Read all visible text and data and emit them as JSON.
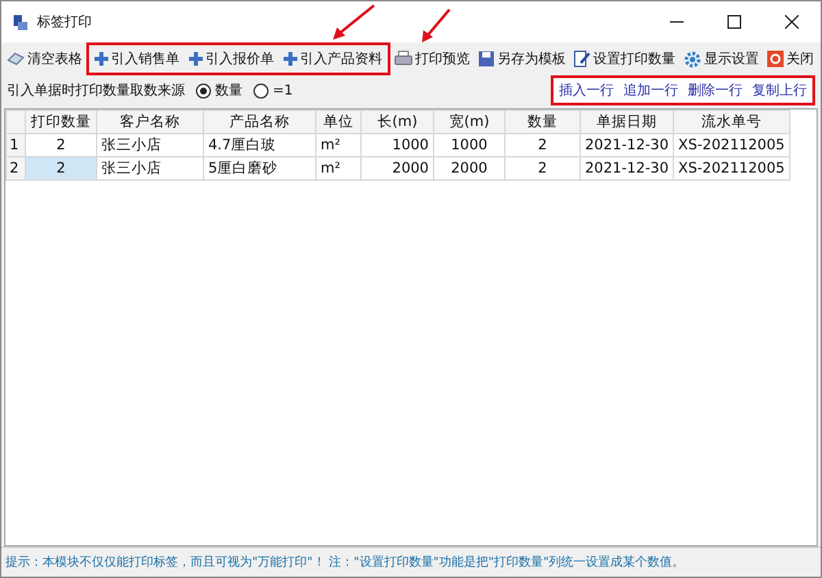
{
  "window": {
    "title": "标签打印"
  },
  "toolbar": {
    "items_before": [
      {
        "label": "清空表格",
        "kind": "eraser"
      }
    ],
    "highlighted_group": [
      {
        "label": "引入销售单",
        "kind": "plus"
      },
      {
        "label": "引入报价单",
        "kind": "plus"
      },
      {
        "label": "引入产品资料",
        "kind": "plus"
      }
    ],
    "items_after": [
      {
        "label": "打印预览",
        "kind": "printer"
      },
      {
        "label": "另存为模板",
        "kind": "save"
      },
      {
        "label": "设置打印数量",
        "kind": "edit"
      },
      {
        "label": "显示设置",
        "kind": "gear"
      },
      {
        "label": "关闭",
        "kind": "close"
      }
    ]
  },
  "options": {
    "label": "引入单据时打印数量取数来源",
    "radios": [
      {
        "label": "数量",
        "selected": true
      },
      {
        "label": "=1",
        "selected": false
      }
    ]
  },
  "row_actions": [
    "插入一行",
    "追加一行",
    "删除一行",
    "复制上行"
  ],
  "table": {
    "columns": [
      "打印数量",
      "客户名称",
      "产品名称",
      "单位",
      "长(m)",
      "宽(m)",
      "数量",
      "单据日期",
      "流水单号"
    ],
    "rows": [
      {
        "number": "1",
        "current": false,
        "cells": [
          "2",
          "张三小店",
          "4.7厘白玻",
          "m²",
          "1000",
          "1000",
          "2",
          "2021-12-30",
          "XS-202112005"
        ]
      },
      {
        "number": "2",
        "current": true,
        "cells": [
          "2",
          "张三小店",
          "5厘白磨砂",
          "m²",
          "2000",
          "2000",
          "2",
          "2021-12-30",
          "XS-202112005"
        ]
      }
    ]
  },
  "status_bar": "提示：本模块不仅仅能打印标签，而且可视为\"万能打印\"！ 注：\"设置打印数量\"功能是把\"打印数量\"列统一设置成某个数值。"
}
